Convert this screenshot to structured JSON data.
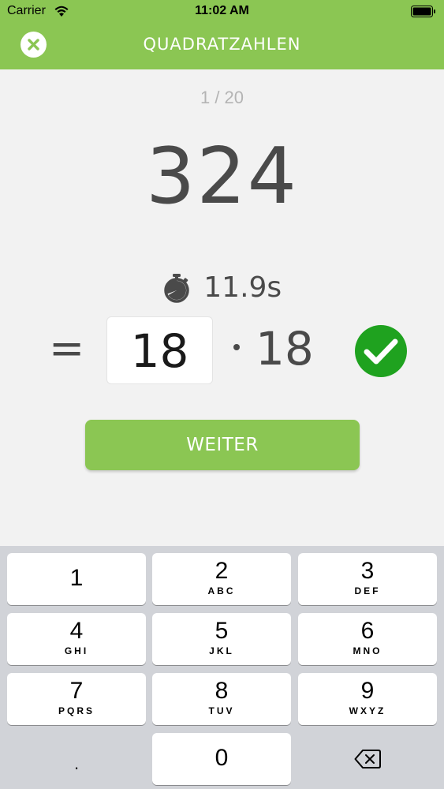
{
  "status_bar": {
    "carrier": "Carrier",
    "time": "11:02 AM"
  },
  "nav": {
    "title": "QUADRATZAHLEN",
    "close_icon": "close-icon"
  },
  "quiz": {
    "progress": "1 / 20",
    "number": "324",
    "timer": "11.9s",
    "equals": "=",
    "answer": "18",
    "factor": "18",
    "result_icon": "check-circle-icon",
    "next_label": "WEITER"
  },
  "keypad": {
    "keys": [
      {
        "digit": "1",
        "letters": ""
      },
      {
        "digit": "2",
        "letters": "ABC"
      },
      {
        "digit": "3",
        "letters": "DEF"
      },
      {
        "digit": "4",
        "letters": "GHI"
      },
      {
        "digit": "5",
        "letters": "JKL"
      },
      {
        "digit": "6",
        "letters": "MNO"
      },
      {
        "digit": "7",
        "letters": "PQRS"
      },
      {
        "digit": "8",
        "letters": "TUV"
      },
      {
        "digit": "9",
        "letters": "WXYZ"
      }
    ],
    "decimal": ".",
    "zero": "0",
    "backspace_icon": "backspace-icon"
  },
  "colors": {
    "accent": "#8bc653",
    "check": "#1fa21f",
    "text": "#4a4a4a",
    "background": "#f2f2f2"
  }
}
